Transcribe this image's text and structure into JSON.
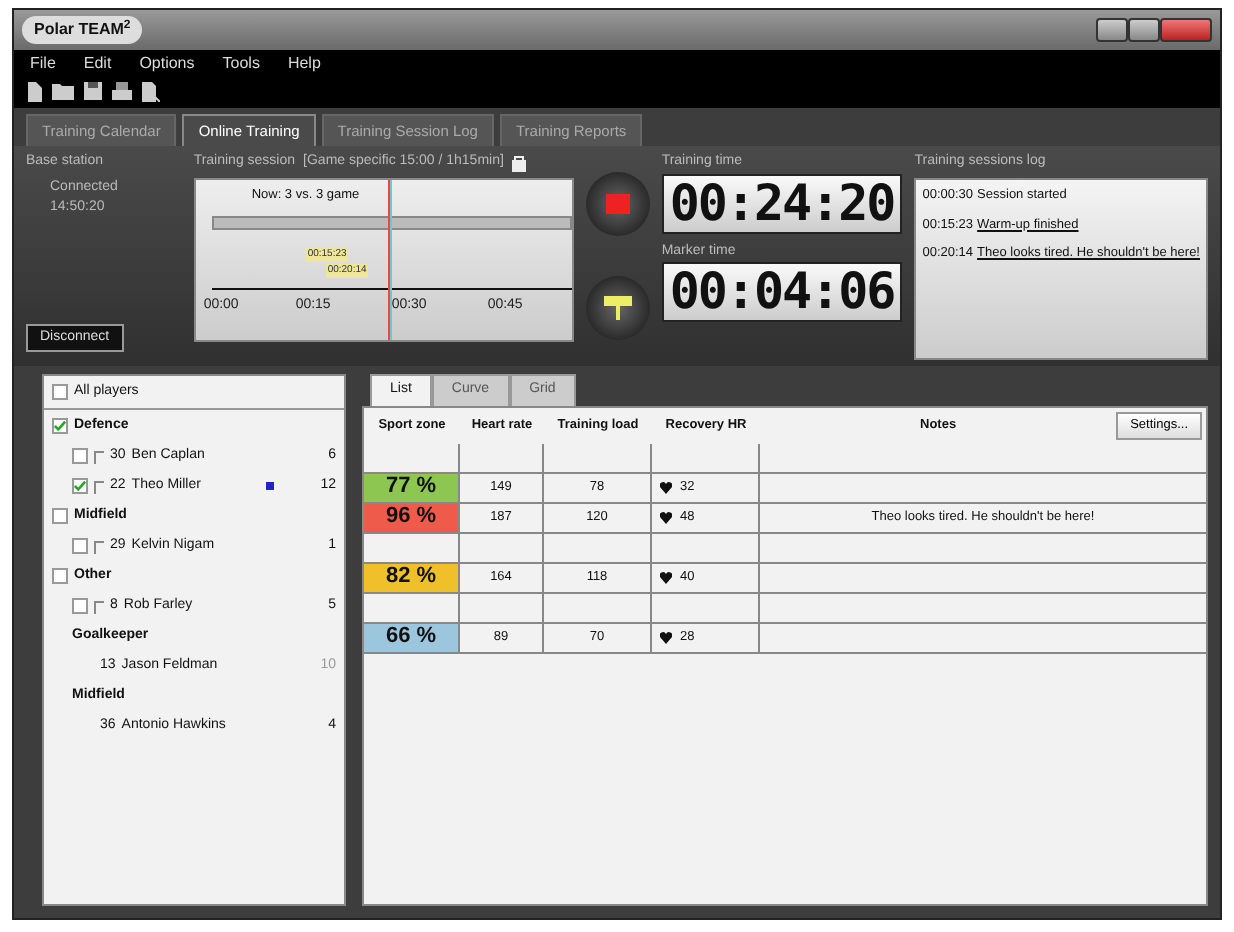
{
  "window": {
    "title": "Polar TEAM$^{2}$"
  },
  "menu": [
    "File",
    "Edit",
    "Options",
    "Tools",
    "Help"
  ],
  "tabs": [
    {
      "label": "Training Calendar",
      "selected": false
    },
    {
      "label": "Online Training",
      "selected": true
    },
    {
      "label": "Training Session Log",
      "selected": false
    },
    {
      "label": "Training Reports",
      "selected": false
    }
  ],
  "base_station": {
    "label": "Base station",
    "status": "Connected",
    "time": "14:50:20",
    "button": "Disconnect"
  },
  "session": {
    "label": "Training session",
    "name": "[Game specific 15:00 / 1h15min]",
    "phase": "Now: 3 vs. 3 game",
    "markers": [
      "00:15:23",
      "00:20:14"
    ],
    "ticks": [
      "00:00",
      "00:15",
      "00:30",
      "00:45"
    ]
  },
  "training_time": {
    "label": "Training time",
    "value": "00:24:20"
  },
  "marker_time": {
    "label": "Marker time",
    "value": "00:04:06"
  },
  "log": {
    "title": "Training sessions log",
    "entries": [
      {
        "time": "00:00:30",
        "text": "Session started",
        "link": false
      },
      {
        "time": "00:15:23",
        "text": "Warm-up finished",
        "link": true
      },
      {
        "time": "00:20:14",
        "text": "Theo looks tired. He shouldn't be here!",
        "link": true
      }
    ]
  },
  "players": {
    "all": {
      "label": "All players",
      "checked": false
    },
    "groups": [
      {
        "name": "Defence",
        "checked": true,
        "kind": "online",
        "players": [
          {
            "number": "30",
            "name": "Ben Caplan",
            "count": "6",
            "checked": false,
            "marked": false
          },
          {
            "number": "22",
            "name": "Theo Miller",
            "count": "12",
            "checked": true,
            "marked": true
          }
        ]
      },
      {
        "name": "Midfield",
        "checked": false,
        "kind": "online",
        "players": [
          {
            "number": "29",
            "name": "Kelvin Nigam",
            "count": "1",
            "checked": false,
            "marked": false
          }
        ]
      },
      {
        "name": "Other",
        "checked": false,
        "kind": "online",
        "players": [
          {
            "number": "8",
            "name": "Rob Farley",
            "count": "5",
            "checked": false,
            "marked": false
          }
        ]
      },
      {
        "name": "Goalkeeper",
        "kind": "offline",
        "players": [
          {
            "number": "13",
            "name": "Jason Feldman",
            "count": "10"
          }
        ]
      },
      {
        "name": "Midfield",
        "kind": "offline",
        "players": [
          {
            "number": "36",
            "name": "Antonio Hawkins",
            "count": "4"
          }
        ]
      }
    ]
  },
  "view_tabs": [
    {
      "label": "List",
      "selected": true
    },
    {
      "label": "Curve",
      "selected": false
    },
    {
      "label": "Grid",
      "selected": false
    }
  ],
  "settings_button": "Settings...",
  "table": {
    "columns": [
      "Sport zone",
      "Heart rate",
      "Training load",
      "Recovery HR",
      "Notes"
    ],
    "rows": [
      {
        "kind": "group"
      },
      {
        "kind": "player",
        "zone": "77 %",
        "color": "#8dc651",
        "heart_rate": "149",
        "load": "78",
        "recovery": "32"
      },
      {
        "kind": "player",
        "zone": "96 %",
        "color": "#ee5b4a",
        "heart_rate": "187",
        "load": "120",
        "recovery": "48",
        "notes": "Theo looks tired. He shouldn't be here!"
      },
      {
        "kind": "group"
      },
      {
        "kind": "player",
        "zone": "82 %",
        "color": "#efc02a",
        "heart_rate": "164",
        "load": "118",
        "recovery": "40"
      },
      {
        "kind": "group"
      },
      {
        "kind": "player",
        "zone": "66 %",
        "color": "#9cc6de",
        "heart_rate": "89",
        "load": "70",
        "recovery": "28"
      }
    ]
  }
}
